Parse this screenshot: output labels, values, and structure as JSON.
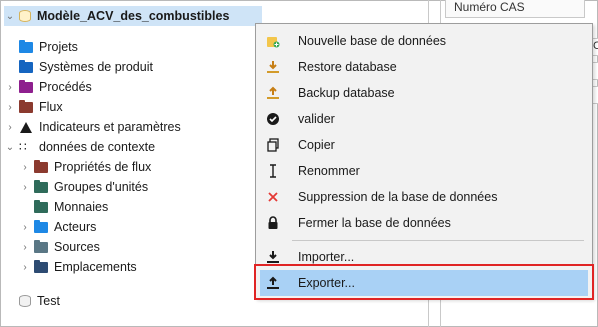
{
  "tree": {
    "items": [
      {
        "label": "Modèle_ACV_des_combustibles",
        "icon": "database-icon",
        "expander": "expanded"
      },
      {
        "label": "Projets",
        "icon": "folder-icon",
        "color": "#1e88e5"
      },
      {
        "label": "Systèmes de produit",
        "icon": "folder-icon",
        "color": "#1565c0"
      },
      {
        "label": "Procédés",
        "icon": "folder-icon",
        "color": "#8e1f8e"
      },
      {
        "label": "Flux",
        "icon": "folder-icon",
        "color": "#8b3a2f"
      },
      {
        "label": "Indicateurs et paramètres",
        "icon": "indicator-icon"
      },
      {
        "label": "données de contexte",
        "icon": "grid-icon"
      },
      {
        "label": "Propriétés de flux",
        "icon": "folder-icon",
        "color": "#8b3a2f"
      },
      {
        "label": "Groupes d'unités",
        "icon": "folder-icon",
        "color": "#2f6b5a"
      },
      {
        "label": "Monnaies",
        "icon": "folder-icon",
        "color": "#2f6b5a"
      },
      {
        "label": "Acteurs",
        "icon": "folder-icon",
        "color": "#1e88e5"
      },
      {
        "label": "Sources",
        "icon": "folder-icon",
        "color": "#5a7785"
      },
      {
        "label": "Emplacements",
        "icon": "folder-icon",
        "color": "#2d4b72"
      },
      {
        "label": "Test",
        "icon": "database-icon"
      }
    ]
  },
  "editor": {
    "column_header": "Numéro CAS",
    "side_fields": [
      "C",
      "",
      ""
    ]
  },
  "context_menu": {
    "items": [
      {
        "label": "Nouvelle base de données",
        "icon": "new-database-icon"
      },
      {
        "label": "Restore database",
        "icon": "restore-icon"
      },
      {
        "label": "Backup database",
        "icon": "backup-icon"
      },
      {
        "label": "valider",
        "icon": "check-circle-icon"
      },
      {
        "label": "Copier",
        "icon": "copy-icon"
      },
      {
        "label": "Renommer",
        "icon": "rename-icon"
      },
      {
        "label": "Suppression de la base de données",
        "icon": "delete-icon"
      },
      {
        "label": "Fermer la base de données",
        "icon": "lock-icon"
      },
      {
        "label": "Importer...",
        "icon": "import-icon"
      },
      {
        "label": "Exporter...",
        "icon": "export-icon",
        "state": "hovered"
      }
    ]
  },
  "colors": {
    "selection": "#cfe4f7",
    "menu_hover": "#a9d1f5",
    "annotation": "#e02424"
  }
}
